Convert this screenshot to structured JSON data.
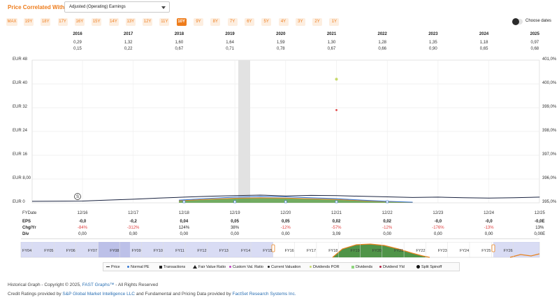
{
  "header": {
    "title": "Price Correlated With",
    "select_value": "Adjusted (Operating) Earnings",
    "ranges": [
      "MAX",
      "19Y",
      "18Y",
      "17Y",
      "16Y",
      "15Y",
      "14Y",
      "13Y",
      "12Y",
      "11Y",
      "10Y",
      "9Y",
      "8Y",
      "7Y",
      "6Y",
      "5Y",
      "4Y",
      "3Y",
      "2Y",
      "1Y"
    ],
    "active_range": "10Y",
    "choose_dates": "Choose dates"
  },
  "years_table": {
    "years": [
      "2016",
      "2017",
      "2018",
      "2019",
      "2020",
      "2021",
      "2022",
      "2023",
      "2024",
      "2025"
    ],
    "row1": [
      "0,29",
      "1,32",
      "1,60",
      "1,64",
      "1,59",
      "1,30",
      "1,28",
      "1,35",
      "1,18",
      "0,97"
    ],
    "row2": [
      "0,15",
      "0,22",
      "0,67",
      "0,71",
      "0,78",
      "0,67",
      "0,66",
      "0,90",
      "0,65",
      "0,68"
    ]
  },
  "chart_data": {
    "type": "line",
    "y_left_ticks": [
      "EUR 48",
      "EUR 40",
      "EUR 32",
      "EUR 24",
      "EUR 16",
      "EUR 8,00",
      "EUR 0"
    ],
    "y_right_ticks": [
      "401,0%",
      "400,0%",
      "399,0%",
      "398,0%",
      "397,0%",
      "396,0%",
      "395,0%"
    ],
    "ylim_left": [
      0,
      48
    ],
    "ylim_right": [
      395.0,
      401.0
    ],
    "x_ticks": [
      "12/16",
      "12/17",
      "12/18",
      "12/19",
      "12/20",
      "12/21",
      "12/22",
      "12/23",
      "12/24",
      "12/25"
    ],
    "series": [
      {
        "name": "Price",
        "color": "#1a2340",
        "x": [
          2016.0,
          2016.5,
          2017.0,
          2017.5,
          2018.0,
          2018.5,
          2019.0,
          2019.5,
          2020.0,
          2020.5,
          2021.0,
          2021.5,
          2022.0,
          2022.5,
          2023.0,
          2023.5,
          2024.0,
          2024.5,
          2025.0
        ],
        "values": [
          0.6,
          0.9,
          1.2,
          1.6,
          1.9,
          2.2,
          2.4,
          2.6,
          2.3,
          2.5,
          2.4,
          2.2,
          2.0,
          1.8,
          1.9,
          1.7,
          1.6,
          1.7,
          1.9
        ]
      },
      {
        "name": "Normal PE",
        "color": "#3a7bd5",
        "x": [
          2017.9,
          2018.5,
          2019.0,
          2019.5,
          2020.0,
          2020.5,
          2021.0,
          2021.5,
          2022.0,
          2022.5
        ],
        "values": [
          0.9,
          1.5,
          1.9,
          2.1,
          2.0,
          1.7,
          1.4,
          0.9,
          0.5,
          0.2
        ]
      }
    ],
    "dividend_points": [
      {
        "x": 2021.0,
        "value": 400.2,
        "color": "#c6d96a"
      },
      {
        "x": 2021.0,
        "value": 398.9,
        "color": "#e04040"
      }
    ],
    "recession_shading": "2020"
  },
  "data_rows": {
    "fydate_label": "FYDate",
    "labels": [
      "EPS",
      "Chg/Yr",
      "Div"
    ],
    "eps": [
      "-0,0",
      "-0,2",
      "0,04",
      "0,05",
      "0,05",
      "0,02",
      "0,02",
      "-0,0",
      "-0,0",
      "-0,0E"
    ],
    "chg": [
      "-84%",
      "-312%",
      "124%",
      "38%",
      "-12%",
      "-57%",
      "-12%",
      "-176%",
      "-13%",
      "13%"
    ],
    "div": [
      "0,00",
      "0,00",
      "0,00",
      "0,00",
      "0,00",
      "3,09",
      "0,00",
      "0,00",
      "0,00",
      "0,00E"
    ]
  },
  "navigator": {
    "labels": [
      "FY04",
      "FY05",
      "FY06",
      "FY07",
      "FY08",
      "FY09",
      "FY10",
      "FY11",
      "FY12",
      "FY13",
      "FY14",
      "FY15",
      "FY16",
      "FY17",
      "FY18",
      "FY19",
      "FY20",
      "FY21",
      "FY22",
      "FY23",
      "FY24",
      "FY25",
      "FY26"
    ]
  },
  "legend": {
    "items": [
      "Price",
      "Normal PE",
      "Transactions",
      "Fair Value Ratio",
      "Custom Val. Ratio",
      "Current Valuation",
      "Dividends POR",
      "Dividends",
      "Dividend Yld",
      "Split Spinoff"
    ]
  },
  "footer": {
    "line1_a": "Historical Graph - Copyright © 2025,",
    "line1_link": "FAST Graphs™",
    "line1_b": "- All Rights Reserved",
    "line2_a": "Credit Ratings provided by",
    "line2_link1": "S&P Global Market Intelligence LLC",
    "line2_b": "and Fundamental and Pricing Data provided by",
    "line2_link2": "FactSet Research Systems Inc."
  }
}
